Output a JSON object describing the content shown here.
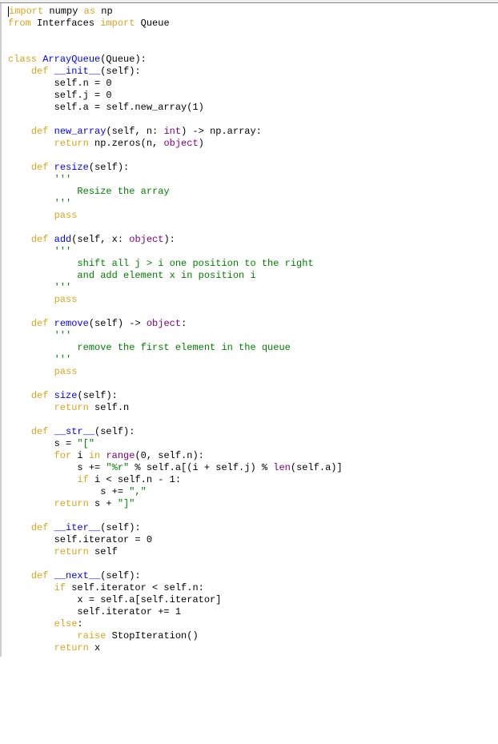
{
  "code": {
    "l1_import": "import",
    "l1_numpy": " numpy ",
    "l1_as": "as",
    "l1_np": " np",
    "l2_from": "from",
    "l2_interfaces": " Interfaces ",
    "l2_import": "import",
    "l2_queue": " Queue",
    "l5_class": "class",
    "l5_name": " ArrayQueue",
    "l5_paren": "(Queue):",
    "l6_def": "def",
    "l6_name": " __init__",
    "l6_paren": "(self):",
    "l7": "        self.n = 0",
    "l8": "        self.j = 0",
    "l9": "        self.a = self.new_array(1)",
    "l11_def": "def",
    "l11_name": " new_array",
    "l11_sig_a": "(self, n: ",
    "l11_int": "int",
    "l11_sig_b": ") -> np.array:",
    "l12_ret": "return",
    "l12_body_a": " np.zeros(n, ",
    "l12_object": "object",
    "l12_body_b": ")",
    "l14_def": "def",
    "l14_name": " resize",
    "l14_paren": "(self):",
    "l15": "        '''",
    "l16": "            Resize the array",
    "l17": "        '''",
    "l18_pass": "pass",
    "l20_def": "def",
    "l20_name": " add",
    "l20_sig_a": "(self, x: ",
    "l20_object": "object",
    "l20_sig_b": "):",
    "l21": "        '''",
    "l22": "            shift all j > i one position to the right",
    "l23": "            and add element x in position i",
    "l24": "        '''",
    "l25_pass": "pass",
    "l27_def": "def",
    "l27_name": " remove",
    "l27_sig_a": "(self) -> ",
    "l27_object": "object",
    "l27_sig_b": ":",
    "l28": "        '''",
    "l29": "            remove the first element in the queue",
    "l30": "        '''",
    "l31_pass": "pass",
    "l33_def": "def",
    "l33_name": " size",
    "l33_paren": "(self):",
    "l34_ret": "return",
    "l34_body": " self.n",
    "l36_def": "def",
    "l36_name": " __str__",
    "l36_paren": "(self):",
    "l37_a": "        s = ",
    "l37_str": "\"[\"",
    "l38_for": "for",
    "l38_a": " i ",
    "l38_in": "in",
    "l38_b": " ",
    "l38_range": "range",
    "l38_c": "(0, self.n):",
    "l39_a": "            s += ",
    "l39_str": "\"%r\"",
    "l39_b": " % self.a[(i + self.j) % ",
    "l39_len": "len",
    "l39_c": "(self.a)]",
    "l40_if": "if",
    "l40_body": " i < self.n - 1:",
    "l41_a": "                s += ",
    "l41_str": "\",\"",
    "l42_ret": "return",
    "l42_a": " s + ",
    "l42_str": "\"]\"",
    "l44_def": "def",
    "l44_name": " __iter__",
    "l44_paren": "(self):",
    "l45": "        self.iterator = 0",
    "l46_ret": "return",
    "l46_body": " self",
    "l48_def": "def",
    "l48_name": " __next__",
    "l48_paren": "(self):",
    "l49_if": "if",
    "l49_body": " self.iterator < self.n:",
    "l50": "            x = self.a[self.iterator]",
    "l51": "            self.iterator += 1",
    "l52_else": "else",
    "l52_colon": ":",
    "l53_raise": "raise",
    "l53_body": " StopIteration()",
    "l54_ret": "return",
    "l54_body": " x"
  }
}
